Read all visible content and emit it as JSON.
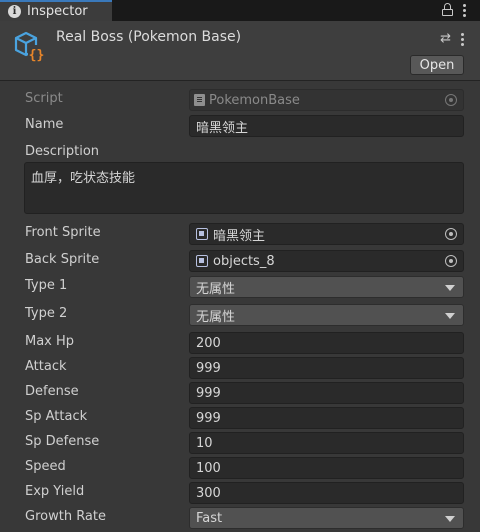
{
  "tab": {
    "title": "Inspector"
  },
  "header": {
    "object_title": "Real Boss (Pokemon Base)",
    "open_label": "Open"
  },
  "fields": {
    "script": {
      "label": "Script",
      "value": "PokemonBase"
    },
    "name": {
      "label": "Name",
      "value": "暗黑领主"
    },
    "description": {
      "label": "Description",
      "value": "血厚，吃状态技能"
    },
    "front_sprite": {
      "label": "Front Sprite",
      "value": "暗黑领主"
    },
    "back_sprite": {
      "label": "Back Sprite",
      "value": "objects_8"
    },
    "type1": {
      "label": "Type 1",
      "value": "无属性"
    },
    "type2": {
      "label": "Type 2",
      "value": "无属性"
    },
    "max_hp": {
      "label": "Max Hp",
      "value": "200"
    },
    "attack": {
      "label": "Attack",
      "value": "999"
    },
    "defense": {
      "label": "Defense",
      "value": "999"
    },
    "sp_attack": {
      "label": "Sp Attack",
      "value": "999"
    },
    "sp_defense": {
      "label": "Sp Defense",
      "value": "10"
    },
    "speed": {
      "label": "Speed",
      "value": "100"
    },
    "exp_yield": {
      "label": "Exp Yield",
      "value": "300"
    },
    "growth_rate": {
      "label": "Growth Rate",
      "value": "Fast"
    }
  },
  "icons": {
    "tab": "info-icon",
    "lock": "lock-icon",
    "menu": "kebab-menu-icon",
    "component": "script-component-icon",
    "presets": "presets-icon",
    "object_picker": "object-picker-icon",
    "dropdown": "dropdown-arrow-icon"
  },
  "colors": {
    "accent": "#3a79bb",
    "background": "#383838",
    "field": "#2a2a2a",
    "icon_blue": "#4aa3df",
    "icon_orange": "#e8862a"
  }
}
